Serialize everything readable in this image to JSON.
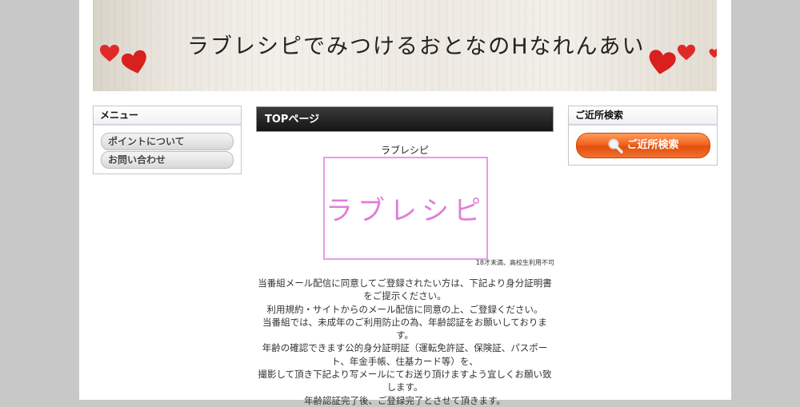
{
  "banner": {
    "title": "ラブレシピでみつけるおとなのHなれんあい"
  },
  "left_menu": {
    "heading": "メニュー",
    "items": [
      {
        "label": "ポイントについて"
      },
      {
        "label": "お問い合わせ"
      }
    ]
  },
  "right_box": {
    "heading": "ご近所検索",
    "button_label": "ご近所検索"
  },
  "main": {
    "heading": "TOPページ",
    "site_name": "ラブレシピ",
    "logo_text": "ラブレシピ",
    "age_note": "18才未満、高校生利用不可",
    "paragraphs": [
      "当番組メール配信に同意してご登録されたい方は、下記より身分証明書をご提示ください。",
      "利用規約・サイトからのメール配信に同意の上、ご登録ください。",
      "当番組では、未成年のご利用防止の為、年齢認証をお願いしております。",
      "年齢の確認できます公的身分証明証（運転免許証、保険証、パスポート、年金手帳、住基カード等）を、",
      "撮影して頂き下記より写メールにてお送り頂けますよう宜しくお願い致します。",
      "年齢認証完了後、ご登録完了とさせて頂きます。"
    ]
  },
  "colors": {
    "page_bg": "#c8c8c8",
    "header_bar": "#1f1f1f",
    "logo_pink": "#e07ed9",
    "search_orange": "#f3641f",
    "heart_red": "#e02a2a"
  },
  "icons": [
    "heart-icon",
    "magnifier-icon"
  ]
}
